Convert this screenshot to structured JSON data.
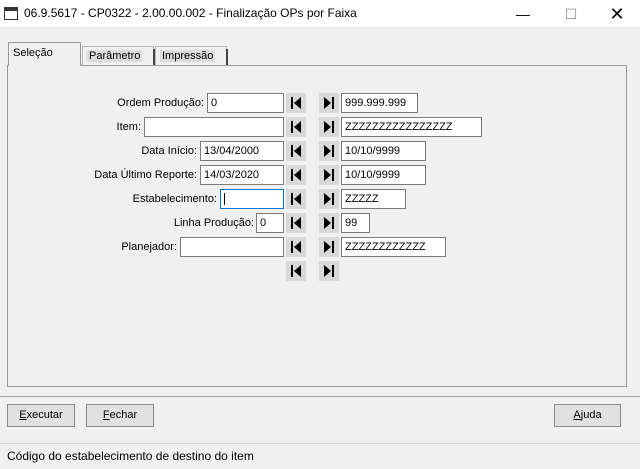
{
  "window": {
    "title": "06.9.5617 - CP0322 - 2.00.00.002 - Finalização OPs por Faixa",
    "minimize": "—",
    "maximize": "☐",
    "close": "✕"
  },
  "tabs": [
    {
      "label": "Seleção",
      "active": true
    },
    {
      "label": "Parâmetro",
      "active": false
    },
    {
      "label": "Impressão",
      "active": false
    }
  ],
  "form": {
    "ordem_producao": {
      "label": "Ordem Produção:",
      "from": "0",
      "to": "999.999.999"
    },
    "item": {
      "label": "Item:",
      "from": "",
      "to": "ZZZZZZZZZZZZZZZZ"
    },
    "data_inicio": {
      "label": "Data Início:",
      "from": "13/04/2000",
      "to": "10/10/9999"
    },
    "data_ultimo_reporte": {
      "label": "Data Último Reporte:",
      "from": "14/03/2020",
      "to": "10/10/9999"
    },
    "estabelecimento": {
      "label": "Estabelecimento:",
      "from": "",
      "to": "ZZZZZ"
    },
    "linha_producao": {
      "label": "Linha Produção:",
      "from": "0",
      "to": "99"
    },
    "planejador": {
      "label": "Planejador:",
      "from": "",
      "to": "ZZZZZZZZZZZZ"
    }
  },
  "buttons": {
    "executar": {
      "mnemonic": "E",
      "rest": "xecutar"
    },
    "fechar": {
      "mnemonic": "F",
      "rest": "echar"
    },
    "ajuda": {
      "mnemonic": "A",
      "rest": "juda"
    }
  },
  "icons": {
    "first": "skip-first-icon",
    "last": "skip-last-icon"
  },
  "status": {
    "text": "Código do estabelecimento de destino do item"
  }
}
